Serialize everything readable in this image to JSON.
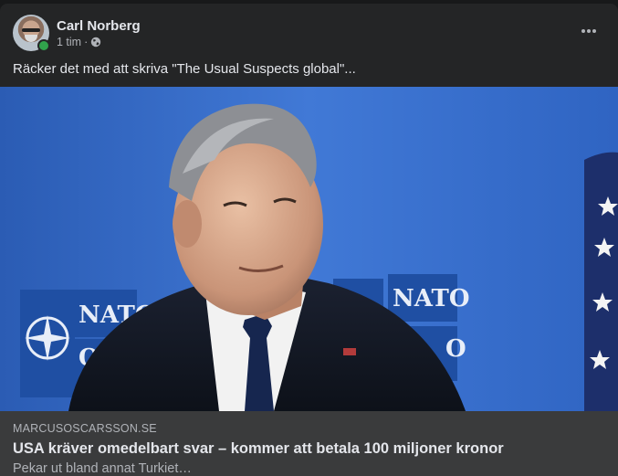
{
  "post": {
    "author": "Carl Norberg",
    "time": "1 tim",
    "separator": "·",
    "audience_icon": "globe-icon",
    "text": "Räcker det med att skriva \"The Usual Suspects global\"...",
    "online": true
  },
  "link": {
    "domain": "MARCUSOSCARSSON.SE",
    "title": "USA kräver omedelbart svar – kommer att betala 100 miljoner kronor",
    "description": "Pekar ut bland annat Turkiet…"
  },
  "photo": {
    "sign_text_left": "NATO",
    "sign_text_left_2": "O",
    "sign_text_right": "NATO",
    "sign_text_right_2": "O"
  },
  "colors": {
    "background": "#18191a",
    "card": "#242526",
    "link_preview": "#3a3b3c",
    "online": "#31a24c",
    "nato_blue": "#2e5fb8"
  }
}
